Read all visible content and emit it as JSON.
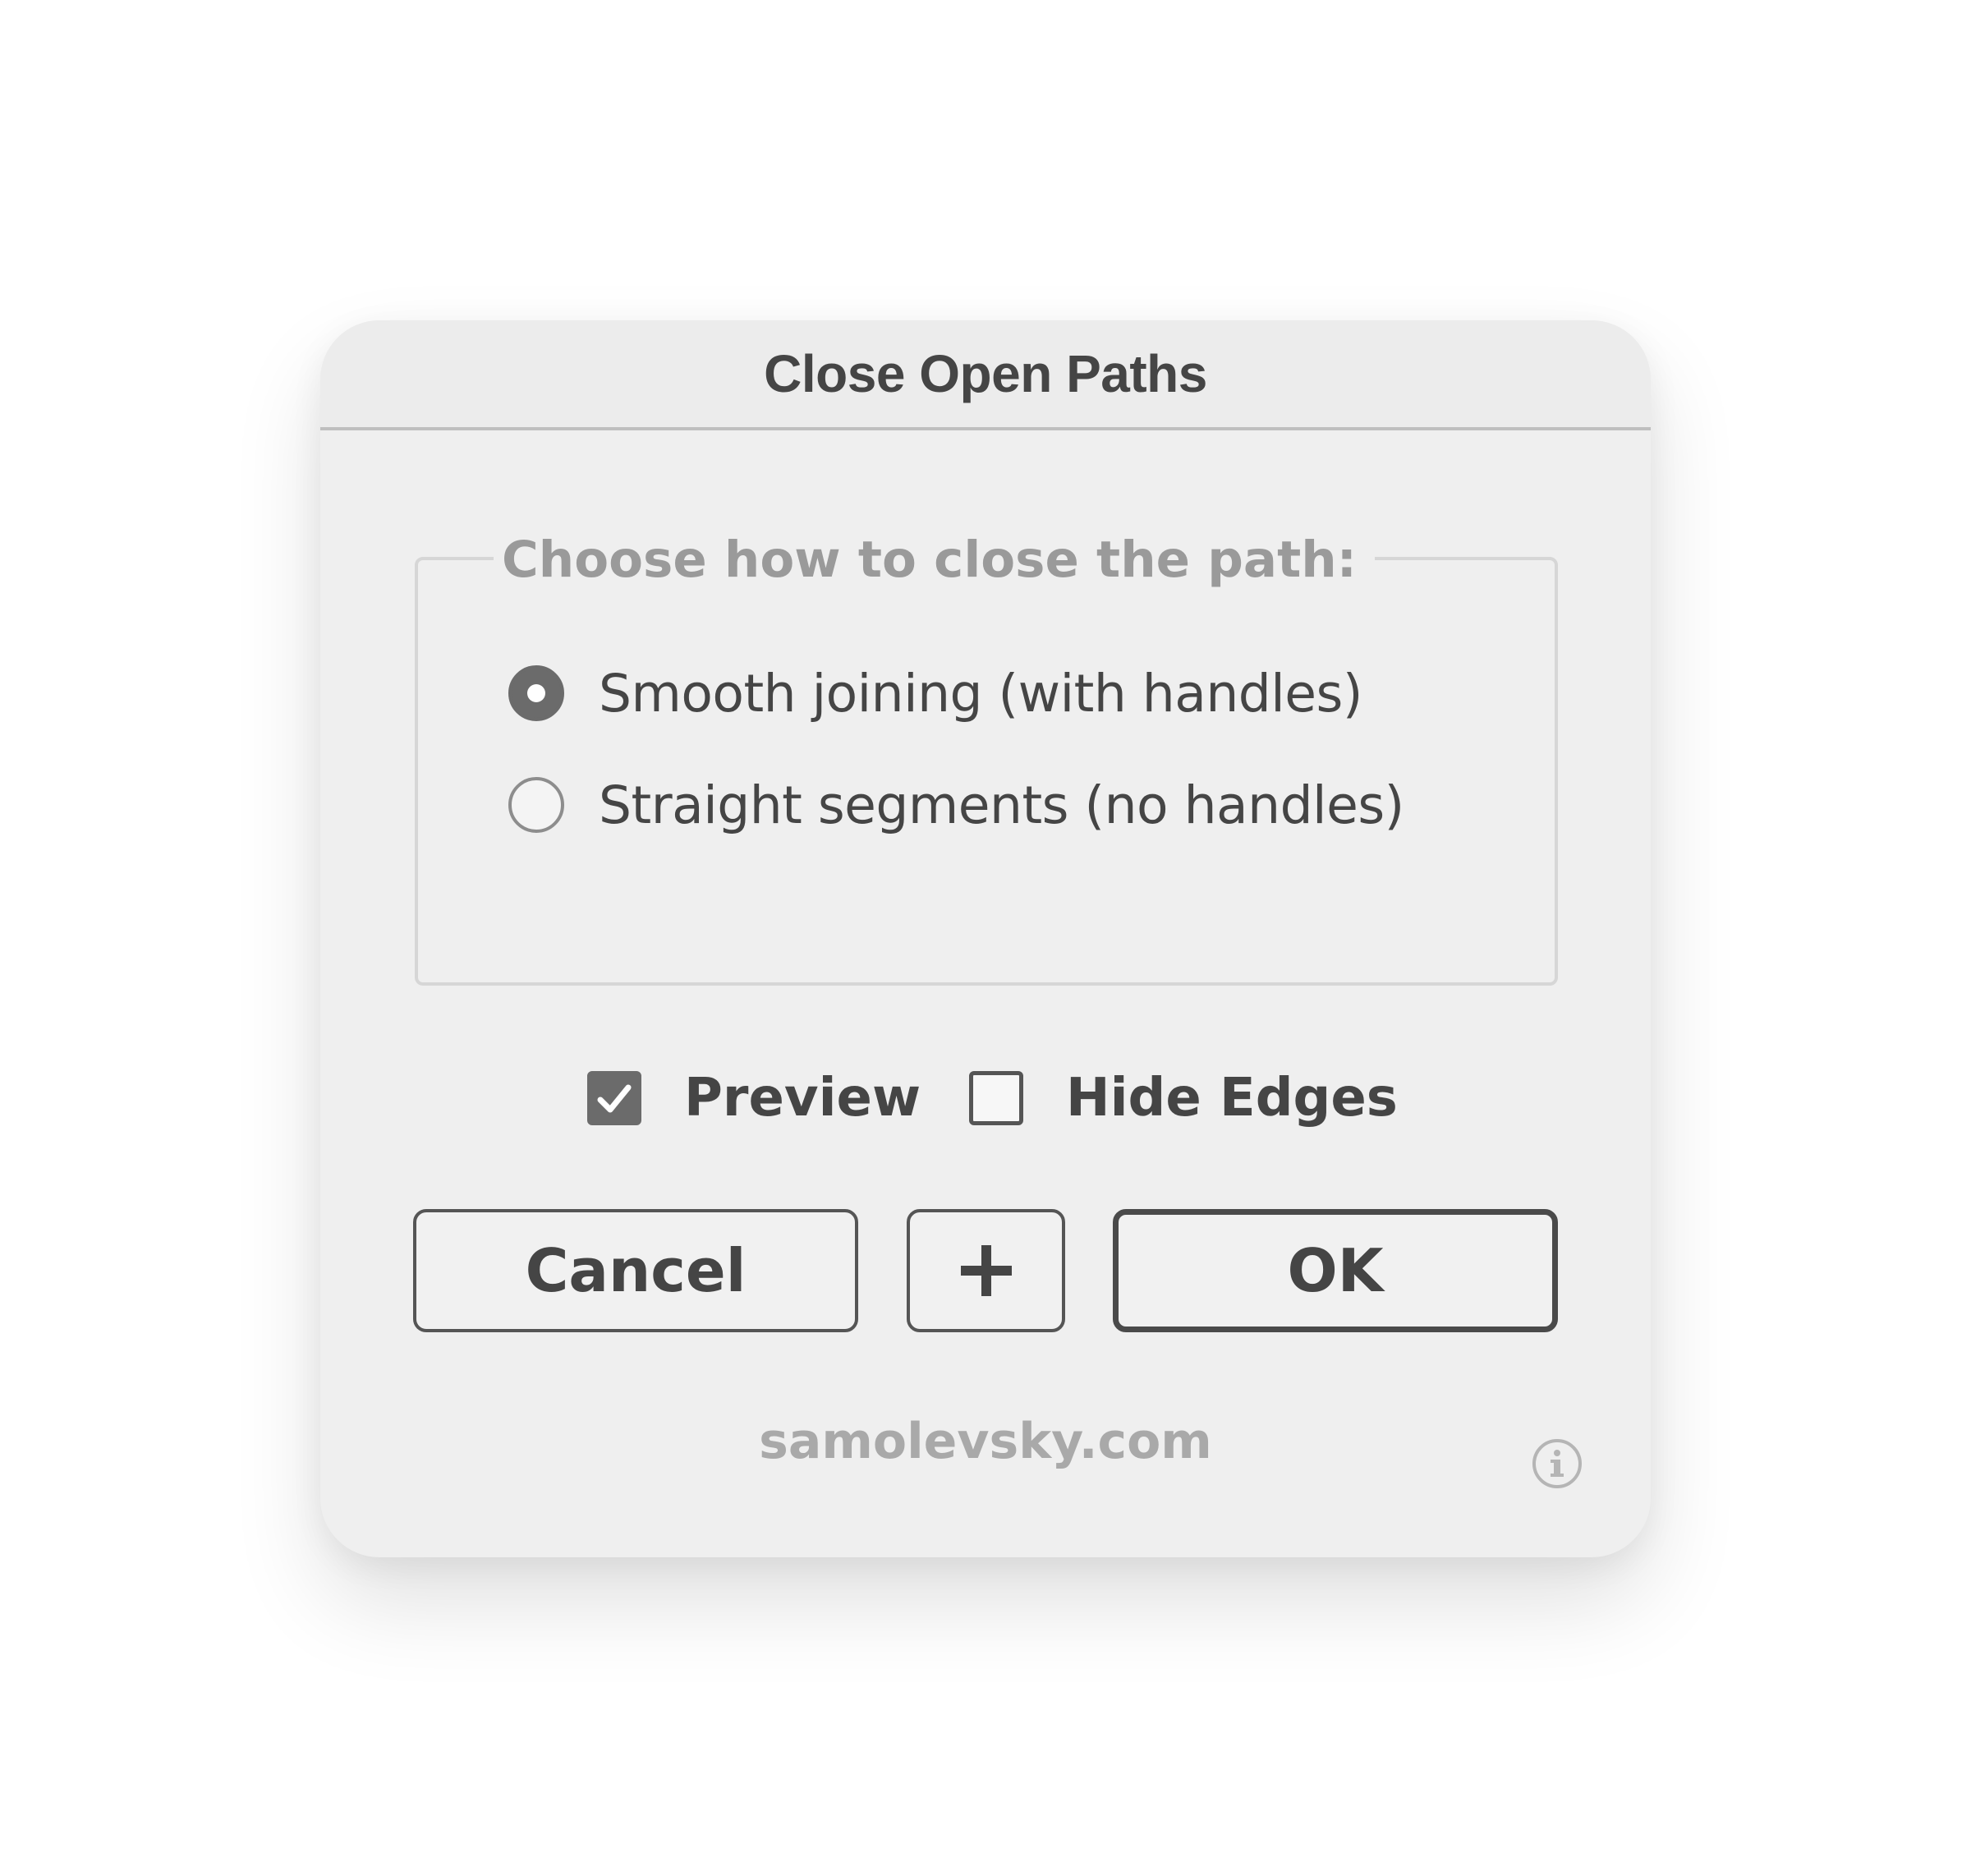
{
  "dialog": {
    "title": "Close Open Paths"
  },
  "group": {
    "legend": "Choose how to close the path:",
    "options": [
      {
        "label": "Smooth joining (with handles)",
        "selected": true
      },
      {
        "label": "Straight segments (no handles)",
        "selected": false
      }
    ]
  },
  "checkboxes": {
    "preview": {
      "label": "Preview",
      "checked": true
    },
    "hide_edges": {
      "label": "Hide Edges",
      "checked": false
    }
  },
  "buttons": {
    "cancel": "Cancel",
    "plus": "+",
    "ok": "OK"
  },
  "footer": {
    "link": "samolevsky.com",
    "info_icon": "info-icon"
  },
  "colors": {
    "dialog_bg": "#efefef",
    "text": "#454545",
    "muted_text": "#9a9a9a",
    "control_fill": "#6b6b6b",
    "border": "#555555"
  }
}
